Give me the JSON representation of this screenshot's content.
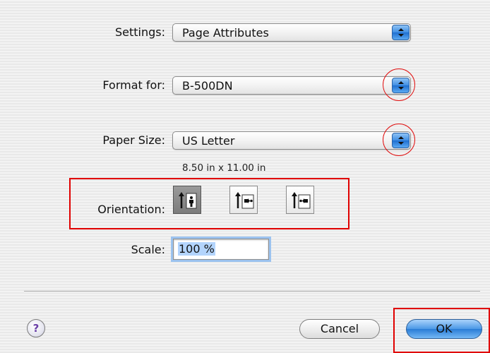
{
  "settings": {
    "label": "Settings:",
    "value": "Page Attributes"
  },
  "format_for": {
    "label": "Format for:",
    "value": "B-500DN"
  },
  "paper_size": {
    "label": "Paper Size:",
    "value": "US Letter",
    "dimensions": "8.50 in x 11.00 in"
  },
  "orientation": {
    "label": "Orientation:",
    "options": [
      {
        "icon": "portrait-orientation-icon",
        "selected": true
      },
      {
        "icon": "landscape-left-orientation-icon",
        "selected": false
      },
      {
        "icon": "landscape-right-orientation-icon",
        "selected": false
      }
    ]
  },
  "scale": {
    "label": "Scale:",
    "value": "100 %"
  },
  "buttons": {
    "help": "?",
    "cancel": "Cancel",
    "ok": "OK"
  },
  "colors": {
    "annotation_red": "#e00000",
    "accent_blue": "#3f8ee3"
  }
}
